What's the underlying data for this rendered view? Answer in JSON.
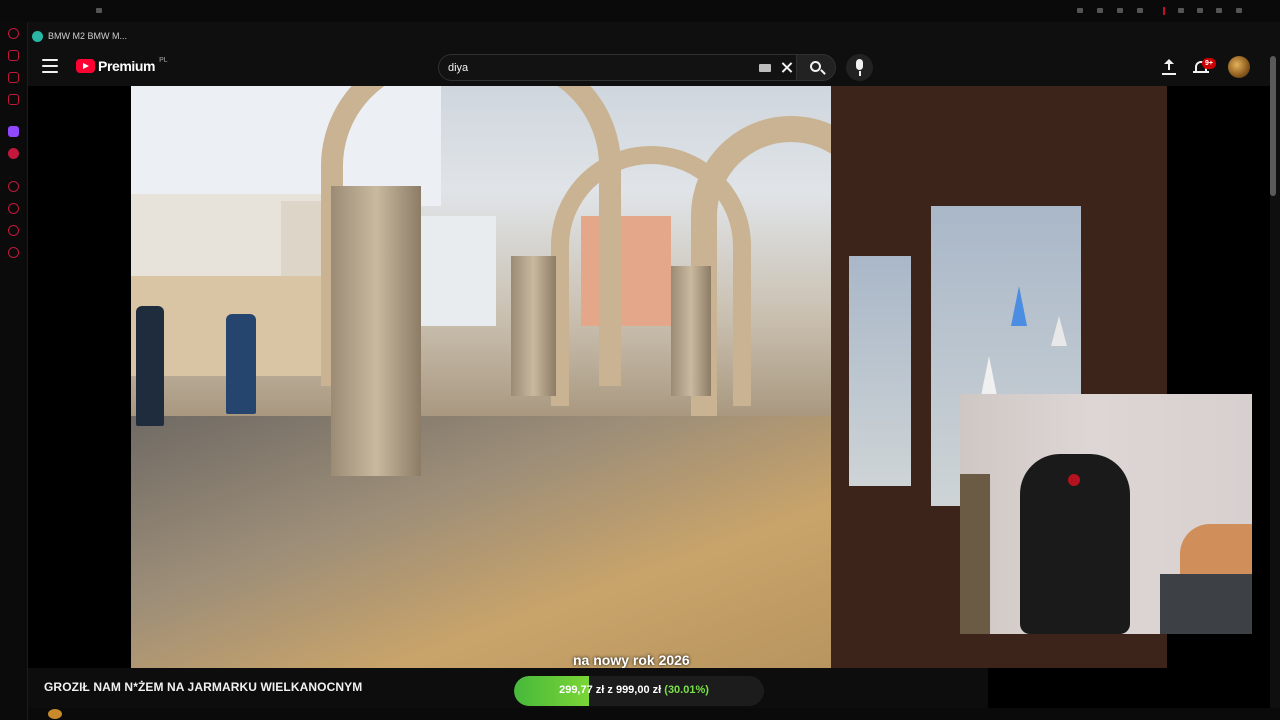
{
  "browser": {
    "tab_title": "BMW M2 BMW M...",
    "accent_color": "#c2183c"
  },
  "header": {
    "logo_text": "Premium",
    "logo_region": "PL",
    "notifications_badge": "9+",
    "icons": [
      "menu-icon",
      "youtube-logo-icon",
      "keyboard-icon",
      "close-icon",
      "search-icon",
      "mic-icon",
      "upload-icon",
      "bell-icon"
    ]
  },
  "search": {
    "value": "diya"
  },
  "video": {
    "caption": "na nowy rok 2026",
    "title": "GROZIŁ NAM N*ŻEM NA JARMARKU WIELKANOCNYM"
  },
  "donation_goal": {
    "text": "299,77 zł z 999,00 zł",
    "percent_label": "(30.01%)",
    "progress_fraction": 0.3001,
    "fill_color": "#47b83c"
  }
}
